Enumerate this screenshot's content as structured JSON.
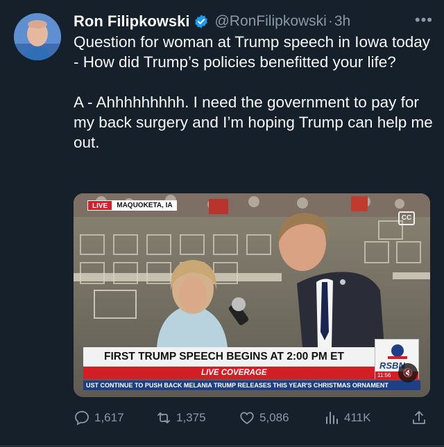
{
  "author": {
    "name": "Ron Filipkowski",
    "handle": "@RonFilipkowski",
    "separator": "·",
    "time": "3h"
  },
  "more_label": "•••",
  "tweet": {
    "lines": [
      "Question for woman at Trump speech in Iowa today - How did Trump’s policies benefitted your life?",
      "A - Ahhhhhhhhh. I need the government to pay for my back surgery and I’m hoping Trump can help me out."
    ]
  },
  "video": {
    "live_label": "LIVE",
    "location": "MAQUOKETA, IA",
    "cc_label": "CC",
    "headline": "FIRST TRUMP SPEECH BEGINS AT 2:00 PM ET",
    "live_coverage": "LIVE COVERAGE",
    "ticker": "UST CONTINUE TO PUSH BACK   MELANIA TRUMP RELEASES THIS YEAR'S CHRISTMAS ORNAMENT",
    "network": "RSBN",
    "clock": "11:56",
    "mute_label": "🔇"
  },
  "actions": {
    "replies": "1,617",
    "reposts": "1,375",
    "likes": "5,086",
    "views": "411K"
  },
  "icons": [
    "verified-icon",
    "more-icon",
    "reply-icon",
    "repost-icon",
    "like-icon",
    "views-icon",
    "share-icon",
    "cc-icon",
    "mute-icon"
  ],
  "colors": {
    "background": "#15202b",
    "text": "#f7f9f9",
    "secondary": "#8b98a5",
    "verified": "#1d9bf0"
  }
}
